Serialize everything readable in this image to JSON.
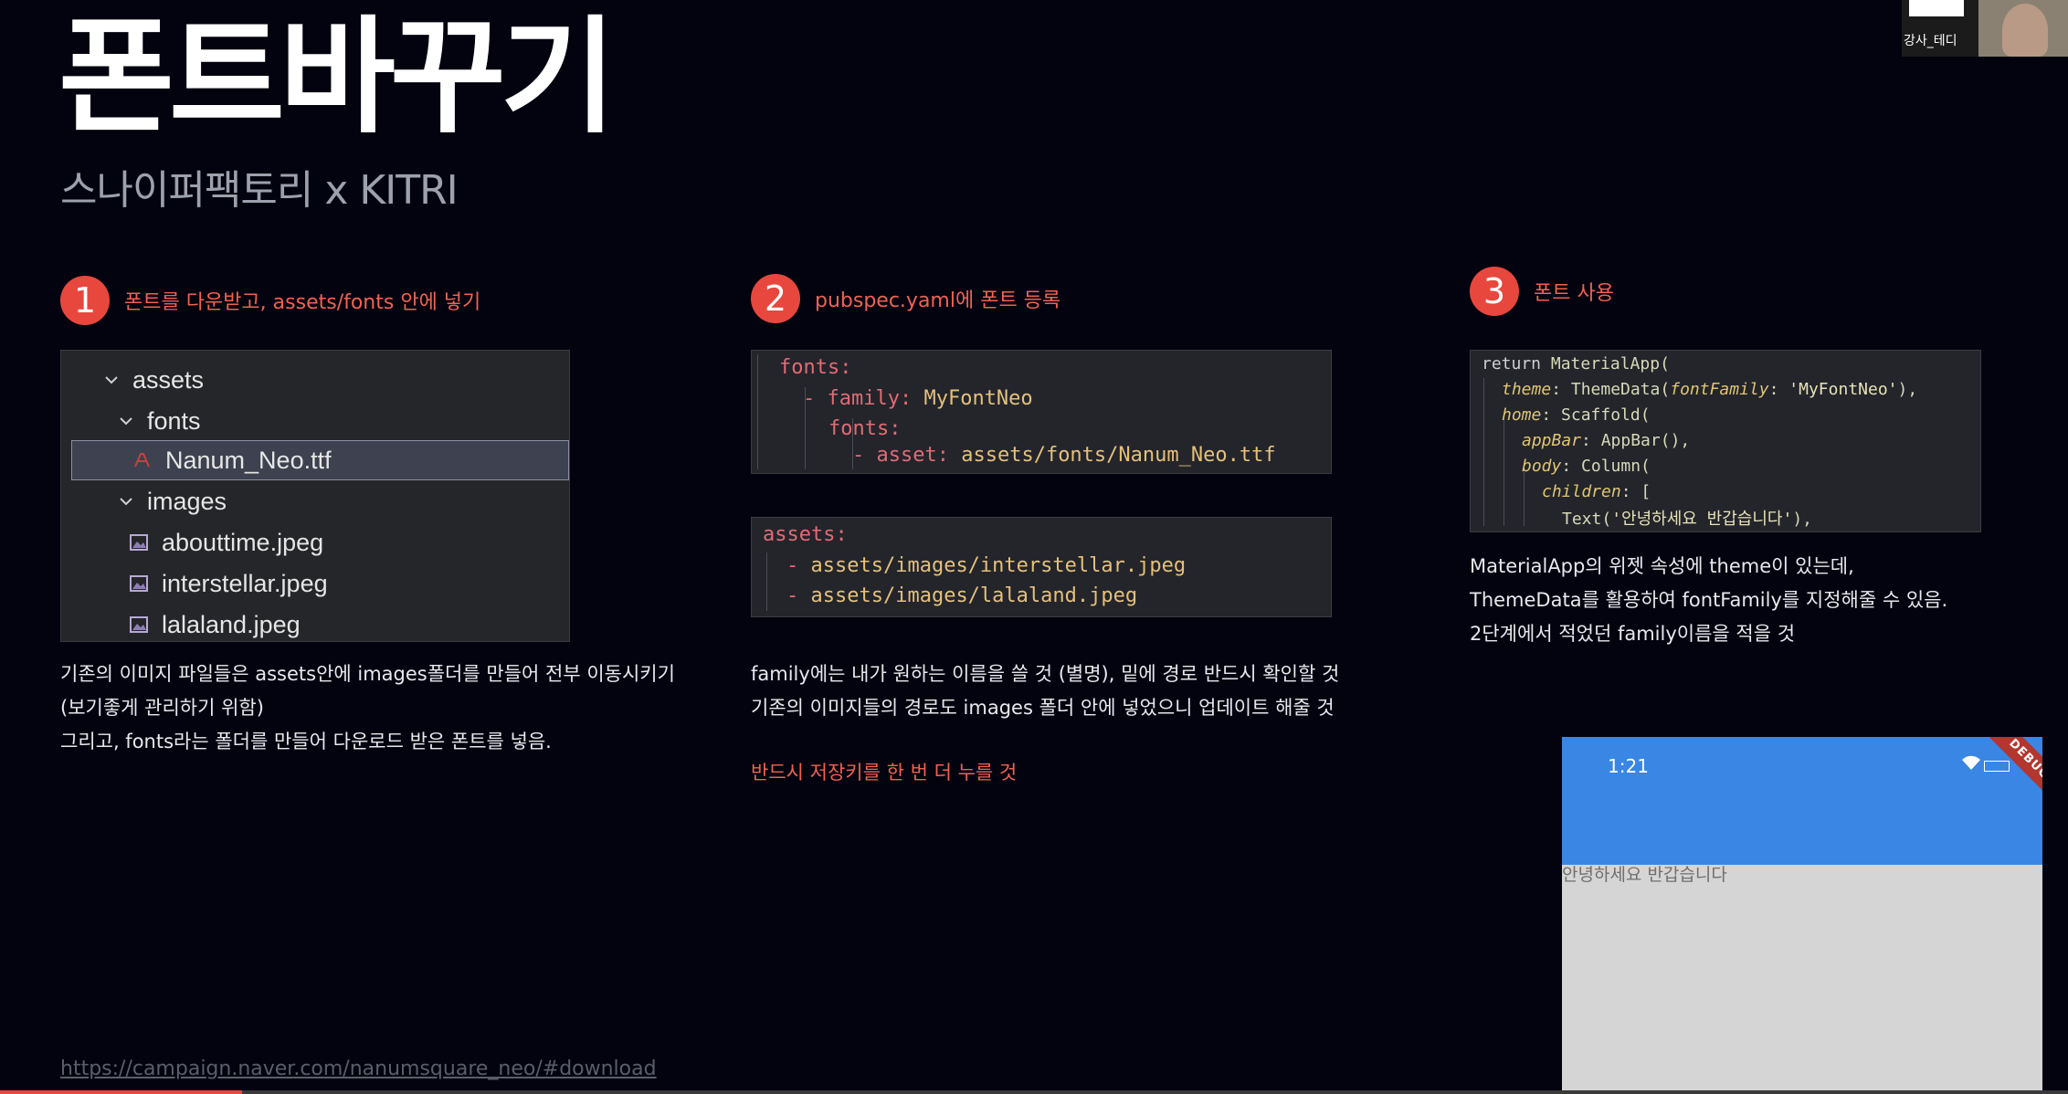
{
  "header": {
    "title": "폰트바꾸기",
    "subtitle": "스나이퍼팩토리 x KITRI"
  },
  "webcam": {
    "label": "강사_테디"
  },
  "steps": [
    {
      "number": "1",
      "title": "폰트를 다운받고, assets/fonts 안에 넣기",
      "tree": [
        {
          "name": "assets",
          "type": "folder"
        },
        {
          "name": "fonts",
          "type": "folder"
        },
        {
          "name": "Nanum_Neo.ttf",
          "type": "font-file",
          "selected": true
        },
        {
          "name": "images",
          "type": "folder"
        },
        {
          "name": "abouttime.jpeg",
          "type": "image-file"
        },
        {
          "name": "interstellar.jpeg",
          "type": "image-file"
        },
        {
          "name": "lalaland.jpeg",
          "type": "image-file"
        }
      ],
      "description": [
        "기존의 이미지 파일들은 assets안에 images폴더를 만들어 전부 이동시키기",
        "(보기좋게 관리하기 위함)",
        "그리고, fonts라는 폴더를 만들어 다운로드 받은 폰트를 넣음."
      ]
    },
    {
      "number": "2",
      "title": "pubspec.yaml에 폰트 등록",
      "code_fonts": {
        "l1": "fonts:",
        "l2_dash": "- ",
        "l2_key": "family:",
        "l2_val": " MyFontNeo",
        "l3": "fonts:",
        "l4_dash": "- ",
        "l4_key": "asset:",
        "l4_val": " assets/fonts/Nanum_Neo.ttf"
      },
      "code_assets": {
        "l1": "assets:",
        "l2_dash": "- ",
        "l2_val": "assets/images/interstellar.jpeg",
        "l3_dash": "- ",
        "l3_val": "assets/images/lalaland.jpeg"
      },
      "description": [
        "family에는 내가 원하는 이름을 쓸 것 (별명), 밑에 경로 반드시 확인할 것",
        "기존의 이미지들의 경로도 images 폴더 안에 넣었으니 업데이트 해줄 것"
      ],
      "warning": "반드시 저장키를 한 번 더 누를 것"
    },
    {
      "number": "3",
      "title": "폰트 사용",
      "code": {
        "l1_kw": "return ",
        "l1_cls": "MaterialApp(",
        "l2_key": "theme",
        "l2_rest": ": ThemeData(",
        "l2_key2": "fontFamily",
        "l2_rest2": ": ",
        "l2_str": "'MyFontNeo'",
        "l2_end": "),",
        "l3_key": "home",
        "l3_rest": ": Scaffold(",
        "l4_key": "appBar",
        "l4_rest": ": AppBar(),",
        "l5_key": "body",
        "l5_rest": ": Column(",
        "l6_key": "children",
        "l6_rest": ": [",
        "l7_cls": "Text(",
        "l7_str": "'안녕하세요 반갑습니다'",
        "l7_end": "),"
      },
      "description": [
        "MaterialApp의 위젯 속성에 theme이 있는데,",
        "ThemeData를 활용하여 fontFamily를 지정해줄 수 있음.",
        "2단계에서 적었던 family이름을 적을 것"
      ]
    }
  ],
  "phone": {
    "time": "1:21",
    "banner": "DEBUG",
    "body_text": "안녕하세요 반갑습니다",
    "appbar_color": "#3a86e4"
  },
  "footer": {
    "link": "https://campaign.naver.com/nanumsquare_neo/#download"
  },
  "video": {
    "progress": 0.117
  },
  "colors": {
    "accent": "#e8473e",
    "background": "#02030f"
  }
}
